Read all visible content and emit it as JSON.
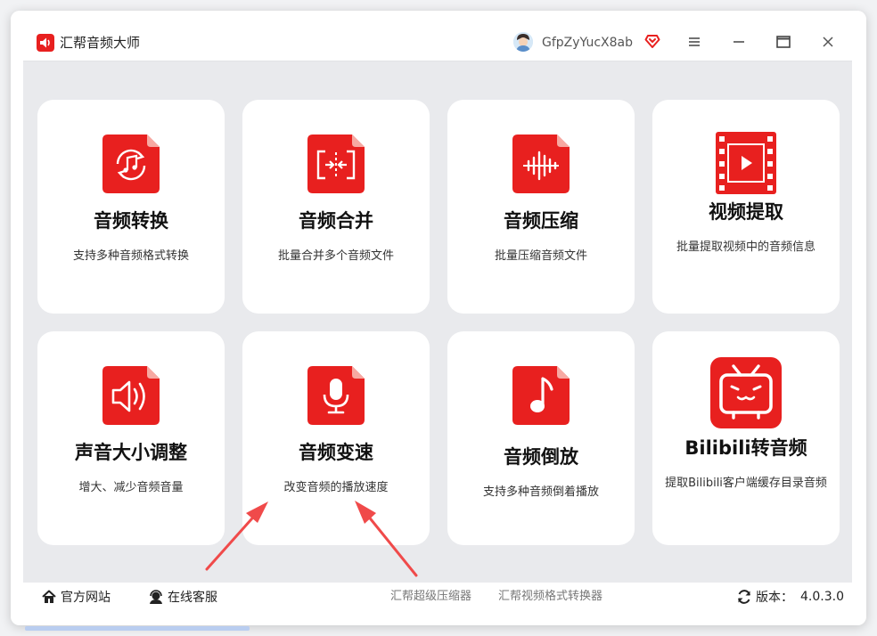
{
  "app": {
    "title": "汇帮音频大师",
    "logo_icon": "speaker-logo-icon",
    "accent": "#e8201f"
  },
  "user": {
    "name": "GfpZyYucX8ab",
    "vip_icon": "heart-badge-icon"
  },
  "window_controls": {
    "menu": "menu-icon",
    "minimize": "minimize-icon",
    "maximize": "maximize-icon",
    "close": "close-icon"
  },
  "cards": [
    {
      "title": "音频转换",
      "desc": "支持多种音频格式转换",
      "icon": "audio-convert-icon"
    },
    {
      "title": "音频合并",
      "desc": "批量合并多个音频文件",
      "icon": "audio-merge-icon"
    },
    {
      "title": "音频压缩",
      "desc": "批量压缩音频文件",
      "icon": "audio-compress-icon"
    },
    {
      "title": "视频提取",
      "desc": "批量提取视频中的音频信息",
      "icon": "video-extract-icon"
    },
    {
      "title": "声音大小调整",
      "desc": "增大、减少音频音量",
      "icon": "volume-adjust-icon"
    },
    {
      "title": "音频变速",
      "desc": "改变音频的播放速度",
      "icon": "microphone-icon"
    },
    {
      "title": "音频倒放",
      "desc": "支持多种音频倒着播放",
      "icon": "music-note-icon"
    },
    {
      "title": "Bilibili转音频",
      "desc": "提取Bilibili客户端缓存目录音频",
      "icon": "bilibili-tv-icon"
    }
  ],
  "footer": {
    "website": "官方网站",
    "support": "在线客服",
    "link1": "汇帮超级压缩器",
    "link2": "汇帮视频格式转换器",
    "version_label": "版本：",
    "version": "4.0.3.0"
  }
}
